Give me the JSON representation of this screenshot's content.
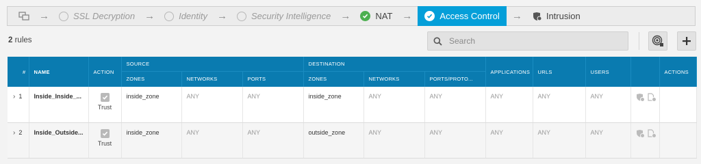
{
  "flow": {
    "steps": [
      {
        "label": "SSL Decryption",
        "state": "inactive"
      },
      {
        "label": "Identity",
        "state": "inactive"
      },
      {
        "label": "Security Intelligence",
        "state": "inactive"
      },
      {
        "label": "NAT",
        "state": "done"
      },
      {
        "label": "Access Control",
        "state": "active"
      },
      {
        "label": "Intrusion",
        "state": "plain"
      }
    ]
  },
  "toolbar": {
    "count_number": "2",
    "count_label": " rules",
    "search_placeholder": "Search"
  },
  "table": {
    "groups": {
      "source": "SOURCE",
      "destination": "DESTINATION"
    },
    "columns": {
      "num": "#",
      "name": "NAME",
      "action": "ACTION",
      "src_zones": "ZONES",
      "src_networks": "NETWORKS",
      "src_ports": "PORTS",
      "dst_zones": "ZONES",
      "dst_networks": "NETWORKS",
      "dst_ports": "PORTS/PROTO...",
      "applications": "APPLICATIONS",
      "urls": "URLS",
      "users": "USERS",
      "actions": "ACTIONS"
    },
    "rows": [
      {
        "num": "1",
        "name": "Inside_Inside_...",
        "action": "Trust",
        "src_zones": "inside_zone",
        "src_networks": "ANY",
        "src_ports": "ANY",
        "dst_zones": "inside_zone",
        "dst_networks": "ANY",
        "dst_ports": "ANY",
        "applications": "ANY",
        "urls": "ANY",
        "users": "ANY"
      },
      {
        "num": "2",
        "name": "Inside_Outside...",
        "action": "Trust",
        "src_zones": "inside_zone",
        "src_networks": "ANY",
        "src_ports": "ANY",
        "dst_zones": "outside_zone",
        "dst_networks": "ANY",
        "dst_ports": "ANY",
        "applications": "ANY",
        "urls": "ANY",
        "users": "ANY"
      }
    ]
  },
  "colors": {
    "accent": "#049fd9",
    "header": "#0a7bb0",
    "success": "#4caf50"
  }
}
